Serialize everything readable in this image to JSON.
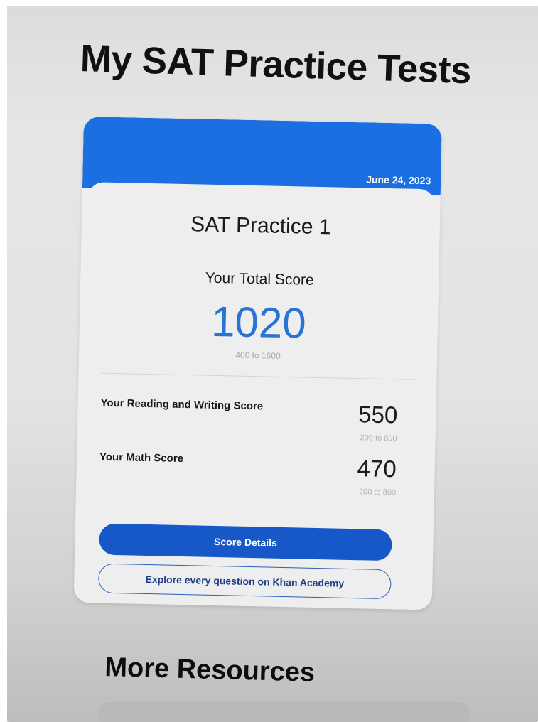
{
  "page": {
    "title": "My SAT Practice Tests"
  },
  "test_card": {
    "date": "June 24, 2023",
    "name": "SAT Practice 1",
    "total_label": "Your Total Score",
    "total_score": "1020",
    "total_range": "400 to 1600",
    "sections": [
      {
        "label": "Your Reading and Writing Score",
        "score": "550",
        "range": "200 to 800"
      },
      {
        "label": "Your Math Score",
        "score": "470",
        "range": "200 to 800"
      }
    ],
    "score_details_button": "Score Details",
    "explore_button": "Explore every question on Khan Academy"
  },
  "more_resources": {
    "title": "More Resources"
  },
  "colors": {
    "header_blue": "#1b6fe0",
    "score_blue": "#2a73d6",
    "button_blue": "#1758c9"
  }
}
